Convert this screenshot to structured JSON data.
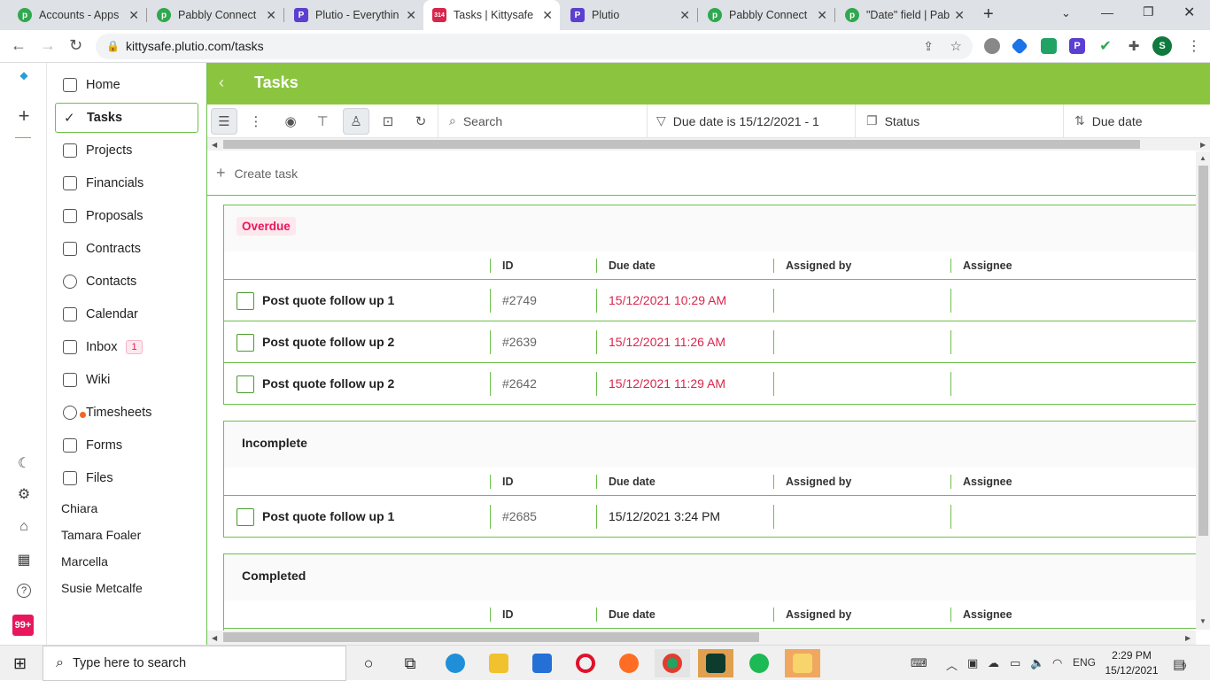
{
  "browser": {
    "tabs": [
      {
        "title": "Accounts - Apps",
        "icon": "pabbly-icon",
        "color": "#2fa84f",
        "active": false
      },
      {
        "title": "Pabbly Connect",
        "icon": "pabbly-icon",
        "color": "#2fa84f",
        "active": false
      },
      {
        "title": "Plutio - Everythin",
        "icon": "plutio-icon",
        "color": "#5b3fd0",
        "active": false
      },
      {
        "title": "Tasks | Kittysafe",
        "icon": "calendar-icon",
        "color": "#d9254c",
        "active": true
      },
      {
        "title": "Plutio",
        "icon": "plutio-icon",
        "color": "#5b3fd0",
        "active": false
      },
      {
        "title": "Pabbly Connect",
        "icon": "pabbly-icon",
        "color": "#2fa84f",
        "active": false
      },
      {
        "title": "\"Date\" field | Pab",
        "icon": "pabbly-icon",
        "color": "#2fa84f",
        "active": false
      }
    ],
    "url": "kittysafe.plutio.com/tasks",
    "calendar_badge": "314",
    "profile_initial": "S",
    "plutio_letter": "P"
  },
  "header": {
    "title": "Tasks"
  },
  "sidebar": {
    "items": [
      {
        "label": "Home",
        "icon": "home-icon"
      },
      {
        "label": "Tasks",
        "icon": "check-icon",
        "active": true
      },
      {
        "label": "Projects",
        "icon": "projects-icon"
      },
      {
        "label": "Financials",
        "icon": "calculator-icon"
      },
      {
        "label": "Proposals",
        "icon": "proposals-icon"
      },
      {
        "label": "Contracts",
        "icon": "contracts-icon"
      },
      {
        "label": "Contacts",
        "icon": "contacts-icon"
      },
      {
        "label": "Calendar",
        "icon": "calendar-icon"
      },
      {
        "label": "Inbox",
        "icon": "inbox-icon",
        "count": "1"
      },
      {
        "label": "Wiki",
        "icon": "wiki-icon"
      },
      {
        "label": "Timesheets",
        "icon": "timer-icon"
      },
      {
        "label": "Forms",
        "icon": "forms-icon"
      },
      {
        "label": "Files",
        "icon": "files-icon"
      }
    ],
    "people": [
      "Chiara",
      "Tamara Foaler",
      "Marcella",
      "Susie Metcalfe"
    ],
    "notification_count": "99+"
  },
  "toolbar": {
    "search_placeholder": "Search",
    "filter": "Due date is 15/12/2021 - 1",
    "status": "Status",
    "sort": "Due date"
  },
  "create_task": "Create task",
  "columns": {
    "id": "ID",
    "due": "Due date",
    "assigned_by": "Assigned by",
    "assignee": "Assignee"
  },
  "groups": [
    {
      "title": "Overdue",
      "tasks": [
        {
          "name": "Post quote follow up 1",
          "id": "#2749",
          "due": "15/12/2021 10:29 AM"
        },
        {
          "name": "Post quote follow up 2",
          "id": "#2639",
          "due": "15/12/2021 11:26 AM"
        },
        {
          "name": "Post quote follow up 2",
          "id": "#2642",
          "due": "15/12/2021 11:29 AM"
        }
      ]
    },
    {
      "title": "Incomplete",
      "tasks": [
        {
          "name": "Post quote follow up 1",
          "id": "#2685",
          "due": "15/12/2021 3:24 PM"
        }
      ]
    },
    {
      "title": "Completed",
      "tasks": []
    }
  ],
  "taskbar": {
    "search_placeholder": "Type here to search",
    "time": "2:29 PM",
    "date": "15/12/2021",
    "lang": "ENG",
    "notifications": "9"
  },
  "colors": {
    "brand_green": "#8bc53f",
    "overdue_red": "#d9254c",
    "accent_pink": "#e8175d"
  }
}
